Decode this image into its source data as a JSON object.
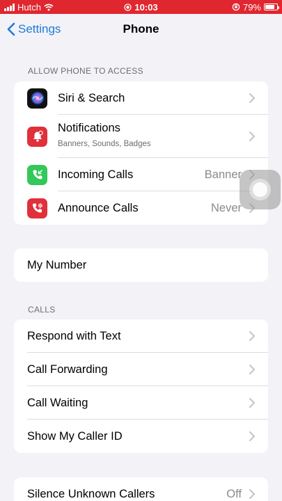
{
  "status_bar": {
    "carrier": "Hutch",
    "time": "10:03",
    "battery_percent": "79%",
    "battery_level": 0.79,
    "icons": [
      "signal-icon",
      "wifi-icon",
      "screen-record-icon",
      "orientation-lock-icon",
      "battery-icon"
    ]
  },
  "nav": {
    "back_label": "Settings",
    "title": "Phone"
  },
  "allow_section": {
    "header": "ALLOW PHONE TO ACCESS",
    "items": [
      {
        "label": "Siri & Search",
        "icon": "siri-icon"
      },
      {
        "label": "Notifications",
        "sublabel": "Banners, Sounds, Badges",
        "icon": "notifications-icon",
        "icon_color": "#e0303a"
      },
      {
        "label": "Incoming Calls",
        "value": "Banner",
        "icon": "incoming-call-icon",
        "icon_color": "#34c759"
      },
      {
        "label": "Announce Calls",
        "value": "Never",
        "icon": "announce-call-icon",
        "icon_color": "#e0303a"
      }
    ]
  },
  "my_number": {
    "label": "My Number"
  },
  "calls_section": {
    "header": "CALLS",
    "items": [
      {
        "label": "Respond with Text"
      },
      {
        "label": "Call Forwarding"
      },
      {
        "label": "Call Waiting"
      },
      {
        "label": "Show My Caller ID"
      }
    ]
  },
  "silence": {
    "label": "Silence Unknown Callers",
    "value": "Off"
  },
  "colors": {
    "accent": "#1d7bd9",
    "status_bar": "#e0262f",
    "background": "#f2f2f7"
  }
}
